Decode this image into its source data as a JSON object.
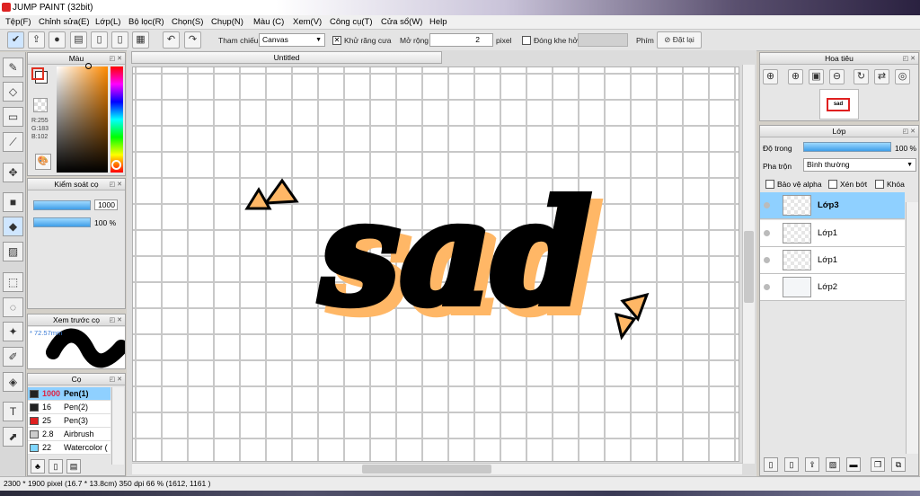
{
  "window": {
    "title": "JUMP PAINT (32bit)"
  },
  "menu": [
    "Tệp(F)",
    "Chỉnh sửa(E)",
    "Lớp(L)",
    "Bộ lọc(R)",
    "Chọn(S)",
    "Chụp(N)",
    "Màu (C)",
    "Xem(V)",
    "Công cụ(T)",
    "Cửa sổ(W)",
    "Help"
  ],
  "toolbar": {
    "reference_label": "Tham chiếu",
    "reference_value": "Canvas",
    "antialias_label": "Khử răng cưa",
    "expand_label": "Mở rộng",
    "expand_value": "2",
    "expand_unit": "pixel",
    "close_gap_label": "Đóng khe hở",
    "key_label": "Phím",
    "reset_label": "Đặt lại"
  },
  "color_panel": {
    "title": "Màu",
    "r": "R:255",
    "g": "G:183",
    "b": "B:102",
    "main_color": "#ffb766"
  },
  "brush_control": {
    "title": "Kiểm soát cọ",
    "size": "1000",
    "opacity": "100",
    "opacity_unit": "%"
  },
  "brush_preview": {
    "title": "Xem trước cọ",
    "size_text": "* 72.57mm"
  },
  "brush_list": {
    "title": "Cọ",
    "items": [
      {
        "size": "1000",
        "name": "Pen(1)",
        "color": "#222222",
        "selected": true
      },
      {
        "size": "16",
        "name": "Pen(2)",
        "color": "#222222"
      },
      {
        "size": "25",
        "name": "Pen(3)",
        "color": "#e02020"
      },
      {
        "size": "2.8",
        "name": "Airbrush",
        "color": "#cccccc"
      },
      {
        "size": "22",
        "name": "Watercolor (",
        "color": "#7fd6ff"
      }
    ]
  },
  "document": {
    "tab_title": "Untitled",
    "art_text": "sad",
    "fill_color": "#ffb766"
  },
  "navigator": {
    "title": "Hoa tiêu"
  },
  "layer_panel": {
    "title": "Lớp",
    "opacity_label": "Độ trong",
    "opacity_value": "100 %",
    "blend_label": "Pha trộn",
    "blend_value": "Bình thường",
    "protect_alpha": "Bảo vệ alpha",
    "clip": "Xén bớt",
    "lock": "Khóa",
    "layers": [
      {
        "name": "Lớp3",
        "selected": true
      },
      {
        "name": "Lớp1"
      },
      {
        "name": "Lớp1"
      },
      {
        "name": "Lớp2"
      }
    ]
  },
  "status": {
    "text": "2300 * 1900 pixel  (16.7 * 13.8cm)  350 dpi  66 %  (1612, 1161 )"
  },
  "colors": {
    "accent": "#3f9ee8",
    "selected_layer": "#8fd0ff",
    "orange": "#ffb766"
  }
}
